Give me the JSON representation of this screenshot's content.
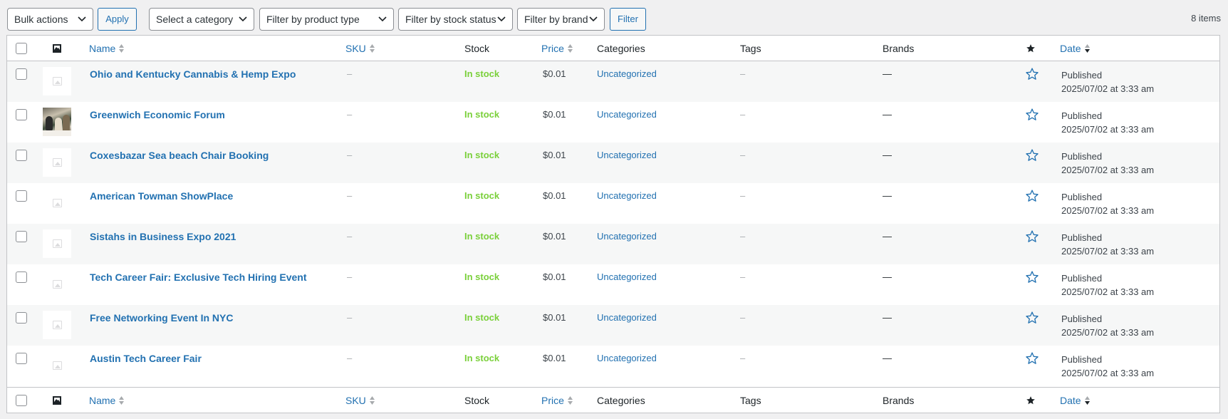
{
  "tablenav": {
    "bulk_actions": "Bulk actions",
    "apply": "Apply",
    "category": "Select a category",
    "product_type": "Filter by product type",
    "stock_status": "Filter by stock status",
    "brand": "Filter by brand",
    "filter": "Filter",
    "items_count": "8 items"
  },
  "columns": {
    "name": "Name",
    "sku": "SKU",
    "stock": "Stock",
    "price": "Price",
    "categories": "Categories",
    "tags": "Tags",
    "brands": "Brands",
    "date": "Date"
  },
  "rows": [
    {
      "name": "Ohio and Kentucky Cannabis & Hemp Expo",
      "sku": "–",
      "stock": "In stock",
      "price": "$0.01",
      "category": "Uncategorized",
      "tags": "–",
      "brands": "—",
      "status": "Published",
      "date": "2025/07/02 at 3:33 am",
      "thumb": "placeholder"
    },
    {
      "name": "Greenwich Economic Forum",
      "sku": "–",
      "stock": "In stock",
      "price": "$0.01",
      "category": "Uncategorized",
      "tags": "–",
      "brands": "—",
      "status": "Published",
      "date": "2025/07/02 at 3:33 am",
      "thumb": "photo"
    },
    {
      "name": "Coxesbazar Sea beach Chair Booking",
      "sku": "–",
      "stock": "In stock",
      "price": "$0.01",
      "category": "Uncategorized",
      "tags": "–",
      "brands": "—",
      "status": "Published",
      "date": "2025/07/02 at 3:33 am",
      "thumb": "placeholder"
    },
    {
      "name": "American Towman ShowPlace",
      "sku": "–",
      "stock": "In stock",
      "price": "$0.01",
      "category": "Uncategorized",
      "tags": "–",
      "brands": "—",
      "status": "Published",
      "date": "2025/07/02 at 3:33 am",
      "thumb": "placeholder"
    },
    {
      "name": "Sistahs in Business Expo 2021",
      "sku": "–",
      "stock": "In stock",
      "price": "$0.01",
      "category": "Uncategorized",
      "tags": "–",
      "brands": "—",
      "status": "Published",
      "date": "2025/07/02 at 3:33 am",
      "thumb": "placeholder"
    },
    {
      "name": "Tech Career Fair: Exclusive Tech Hiring Event",
      "sku": "–",
      "stock": "In stock",
      "price": "$0.01",
      "category": "Uncategorized",
      "tags": "–",
      "brands": "—",
      "status": "Published",
      "date": "2025/07/02 at 3:33 am",
      "thumb": "placeholder"
    },
    {
      "name": "Free Networking Event In NYC",
      "sku": "–",
      "stock": "In stock",
      "price": "$0.01",
      "category": "Uncategorized",
      "tags": "–",
      "brands": "—",
      "status": "Published",
      "date": "2025/07/02 at 3:33 am",
      "thumb": "placeholder"
    },
    {
      "name": "Austin Tech Career Fair",
      "sku": "–",
      "stock": "In stock",
      "price": "$0.01",
      "category": "Uncategorized",
      "tags": "–",
      "brands": "—",
      "status": "Published",
      "date": "2025/07/02 at 3:33 am",
      "thumb": "placeholder"
    }
  ],
  "colors": {
    "link": "#2271b1",
    "in_stock": "#7ad03a",
    "row_alt": "#f6f7f7",
    "border": "#c3c4c7"
  },
  "icons": {
    "thumbnail_column": "image-icon",
    "featured_column": "star-filled-icon",
    "featured_row": "star-outline-icon",
    "sort": "sort-arrows-icon"
  }
}
